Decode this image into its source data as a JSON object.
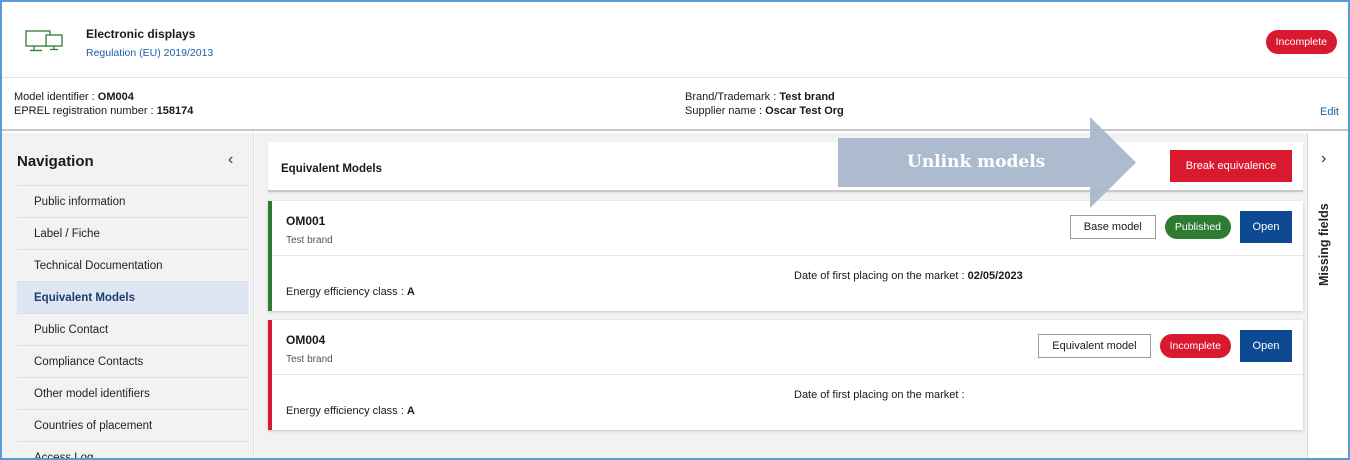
{
  "product": {
    "title": "Electronic displays",
    "regulation": "Regulation (EU) 2019/2013",
    "status": "Incomplete",
    "icon": "monitor-icon"
  },
  "info": {
    "model_identifier_label": "Model identifier : ",
    "model_identifier_value": "OM004",
    "eprel_label": "EPREL registration number : ",
    "eprel_value": "158174",
    "brand_label": "Brand/Trademark : ",
    "brand_value": "Test brand",
    "supplier_label": "Supplier name : ",
    "supplier_value": "Oscar Test Org",
    "edit": "Edit"
  },
  "navigation": {
    "title": "Navigation",
    "collapse_icon": "chevron-left-icon",
    "items": [
      {
        "label": "Public information"
      },
      {
        "label": "Label / Fiche"
      },
      {
        "label": "Technical Documentation"
      },
      {
        "label": "Equivalent Models"
      },
      {
        "label": "Public Contact"
      },
      {
        "label": "Compliance Contacts"
      },
      {
        "label": "Other model identifiers"
      },
      {
        "label": "Countries of placement"
      },
      {
        "label": "Access Log"
      }
    ],
    "active": "Equivalent Models"
  },
  "main": {
    "panel_title": "Equivalent Models",
    "break_button": "Break equivalence",
    "cards": [
      {
        "id": "OM001",
        "brand": "Test brand",
        "role": "Base model",
        "status": "Published",
        "open": "Open",
        "date_label": "Date of first placing on the market : ",
        "date_value": "02/05/2023",
        "energy_label": "Energy efficiency class : ",
        "energy_value": "A"
      },
      {
        "id": "OM004",
        "brand": "Test brand",
        "role": "Equivalent model",
        "status": "Incomplete",
        "open": "Open",
        "date_label": "Date of first placing on the market : ",
        "date_value": "",
        "energy_label": "Energy efficiency class : ",
        "energy_value": "A"
      }
    ]
  },
  "rail": {
    "label": "Missing fields",
    "expand_icon": "chevron-right-icon"
  },
  "callout": {
    "text": "Unlink models"
  },
  "colors": {
    "accent_blue": "#0e4a94",
    "danger_red": "#d9192d",
    "success_green": "#2f7b31",
    "link_blue": "#1a5ea8",
    "callout_arrow": "#a9b7cb"
  }
}
